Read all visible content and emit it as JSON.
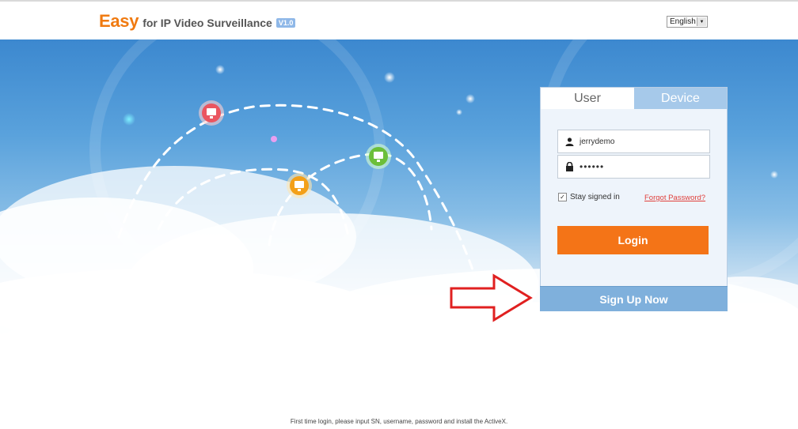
{
  "header": {
    "brand_easy": "Easy",
    "brand_rest": "for IP Video Surveillance",
    "version": "V1.0",
    "language": "English"
  },
  "login": {
    "tabs": [
      "User",
      "Device"
    ],
    "active_tab": "User",
    "username_value": "jerrydemo",
    "password_value": "••••••",
    "stay_signed_in_label": "Stay signed in",
    "stay_signed_in_checked": true,
    "forgot_password": "Forgot Password?",
    "login_button": "Login",
    "signup_button": "Sign Up Now"
  },
  "footer": {
    "hint": "First time login, please input SN, username, password and install the ActiveX."
  },
  "colors": {
    "brand_orange": "#f07a10",
    "login_orange": "#f47417",
    "signup_blue": "#7fb0dc",
    "forgot_red": "#e0403c",
    "arrow_red": "#e02020"
  },
  "icons": {
    "user_field": "user-icon",
    "password_field": "lock-icon",
    "monitor_nodes": [
      "monitor-icon-red",
      "monitor-icon-green",
      "monitor-icon-orange"
    ],
    "annotation": "arrow-right-icon"
  }
}
